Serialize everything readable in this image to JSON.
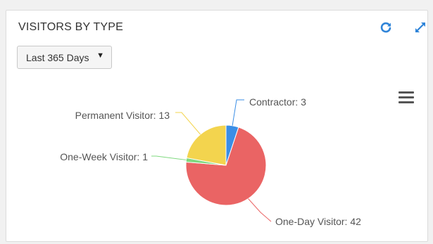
{
  "widget": {
    "title": "VISITORS BY TYPE",
    "refresh_icon": "refresh-icon",
    "expand_icon": "expand-icon",
    "menu_icon": "hamburger-menu-icon"
  },
  "filter": {
    "selected": "Last 365 Days"
  },
  "chart_data": {
    "type": "pie",
    "slices": [
      {
        "label": "Contractor",
        "value": 3,
        "color": "#3a8ee6",
        "display": "Contractor: 3"
      },
      {
        "label": "One-Day Visitor",
        "value": 42,
        "color": "#ea6464",
        "display": "One-Day Visitor: 42"
      },
      {
        "label": "One-Week Visitor",
        "value": 1,
        "color": "#7fd97f",
        "display": "One-Week Visitor: 1"
      },
      {
        "label": "Permanent Visitor",
        "value": 13,
        "color": "#f3d44e",
        "display": "Permanent Visitor: 13"
      }
    ]
  }
}
